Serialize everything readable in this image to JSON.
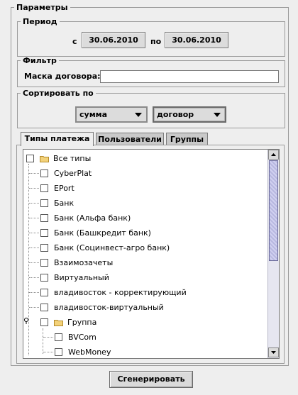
{
  "params": {
    "legend": "Параметры"
  },
  "period": {
    "legend": "Период",
    "from_label": "с",
    "from_value": "30.06.2010",
    "to_label": "по",
    "to_value": "30.06.2010"
  },
  "filter": {
    "legend": "Фильтр",
    "mask_label": "Маска договора:",
    "mask_value": ""
  },
  "sort": {
    "legend": "Сортировать по",
    "first_value": "сумма",
    "second_value": "договор"
  },
  "tabs": [
    {
      "label": "Типы платежа"
    },
    {
      "label": "Пользователи"
    },
    {
      "label": "Группы"
    }
  ],
  "tree": {
    "root": "Все типы",
    "items": [
      "CyberPlat",
      "EPort",
      "Банк",
      "Банк (Альфа банк)",
      "Банк (Башкредит банк)",
      "Банк (Социнвест-агро банк)",
      "Взаимозачеты",
      "Виртуальный",
      "владивосток - корректирующий",
      "владивосток-виртуальный"
    ],
    "group": "Группа",
    "group_children": [
      "BVCom",
      "WebMoney"
    ]
  },
  "generate_label": "Сгенерировать",
  "colors": {
    "panel": "#eeeeee",
    "scroll_thumb": "#b8b8e0"
  }
}
